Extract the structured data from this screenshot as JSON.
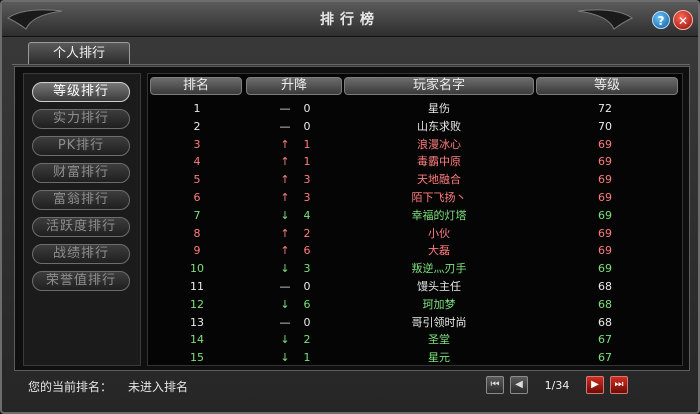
{
  "window": {
    "title": "排行榜"
  },
  "tabs": [
    {
      "label": "个人排行",
      "active": true
    }
  ],
  "sidebar": {
    "buttons": [
      {
        "label": "等级排行",
        "active": true
      },
      {
        "label": "实力排行",
        "active": false
      },
      {
        "label": "PK排行",
        "active": false
      },
      {
        "label": "财富排行",
        "active": false
      },
      {
        "label": "富翁排行",
        "active": false
      },
      {
        "label": "活跃度排行",
        "active": false
      },
      {
        "label": "战绩排行",
        "active": false
      },
      {
        "label": "荣誉值排行",
        "active": false
      }
    ]
  },
  "table": {
    "headers": [
      "排名",
      "升降",
      "玩家名字",
      "等级"
    ],
    "rows": [
      {
        "rank": "1",
        "trend": "—",
        "change": "0",
        "name": "星伤",
        "level": "72",
        "color": "#e9e9e9"
      },
      {
        "rank": "2",
        "trend": "—",
        "change": "0",
        "name": "山东求败",
        "level": "70",
        "color": "#e9e9e9"
      },
      {
        "rank": "3",
        "trend": "↑",
        "change": "1",
        "name": "浪漫冰心",
        "level": "69",
        "color": "#ff7d7d"
      },
      {
        "rank": "4",
        "trend": "↑",
        "change": "1",
        "name": "毒霸中原",
        "level": "69",
        "color": "#ff7d7d"
      },
      {
        "rank": "5",
        "trend": "↑",
        "change": "3",
        "name": "天地融合",
        "level": "69",
        "color": "#ff7d7d"
      },
      {
        "rank": "6",
        "trend": "↑",
        "change": "3",
        "name": "陌下飞扬丶",
        "level": "69",
        "color": "#ff7d7d"
      },
      {
        "rank": "7",
        "trend": "↓",
        "change": "4",
        "name": "幸福的灯塔",
        "level": "69",
        "color": "#7de07d"
      },
      {
        "rank": "8",
        "trend": "↑",
        "change": "2",
        "name": "小伙",
        "level": "69",
        "color": "#ff7d7d"
      },
      {
        "rank": "9",
        "trend": "↑",
        "change": "6",
        "name": "大磊",
        "level": "69",
        "color": "#ff7d7d"
      },
      {
        "rank": "10",
        "trend": "↓",
        "change": "3",
        "name": "叛逆灬刃手",
        "level": "69",
        "color": "#7de07d"
      },
      {
        "rank": "11",
        "trend": "—",
        "change": "0",
        "name": "馒头主任",
        "level": "68",
        "color": "#e9e9e9"
      },
      {
        "rank": "12",
        "trend": "↓",
        "change": "6",
        "name": "珂加梦",
        "level": "68",
        "color": "#7de07d"
      },
      {
        "rank": "13",
        "trend": "—",
        "change": "0",
        "name": "哥引领时尚",
        "level": "68",
        "color": "#e9e9e9"
      },
      {
        "rank": "14",
        "trend": "↓",
        "change": "2",
        "name": "圣堂",
        "level": "67",
        "color": "#7de07d"
      },
      {
        "rank": "15",
        "trend": "↓",
        "change": "1",
        "name": "星元",
        "level": "67",
        "color": "#7de07d"
      }
    ]
  },
  "footer": {
    "current_rank_label": "您的当前排名：",
    "current_rank_value": "未进入排名",
    "page_indicator": "1/34"
  }
}
